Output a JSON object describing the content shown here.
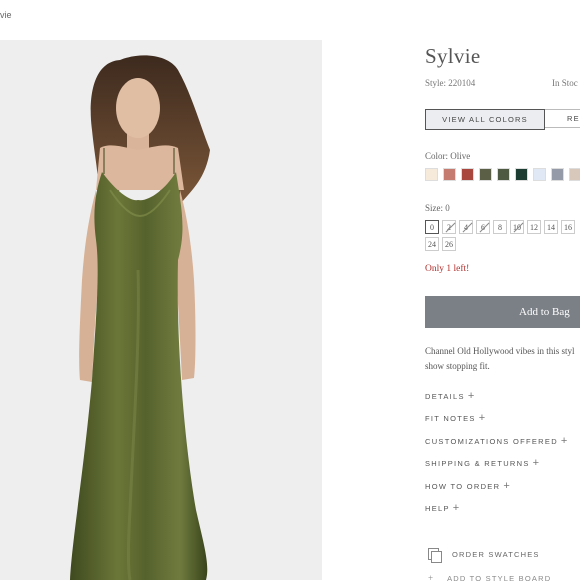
{
  "breadcrumb": {
    "current": "vie"
  },
  "product": {
    "title": "Sylvie",
    "style": "Style: 220104",
    "stock": "In Stoc",
    "view_all_colors": "VIEW ALL COLORS",
    "second_button": "RE",
    "color_label": "Color: Olive",
    "swatches": [
      {
        "name": "ivory",
        "color": "#f6eadb"
      },
      {
        "name": "rose",
        "color": "#c67b70"
      },
      {
        "name": "rust",
        "color": "#a9473f"
      },
      {
        "name": "olive",
        "color": "#5a5f45"
      },
      {
        "name": "moss",
        "color": "#4f5a43"
      },
      {
        "name": "emerald",
        "color": "#1c3d32"
      },
      {
        "name": "sky",
        "color": "#dfe8f4"
      },
      {
        "name": "slate",
        "color": "#959aa8"
      },
      {
        "name": "taupe",
        "color": "#d8c8bc"
      }
    ],
    "size_label": "Size: 0",
    "sizes": [
      {
        "label": "0",
        "state": "selected"
      },
      {
        "label": "2",
        "state": "soldout"
      },
      {
        "label": "4",
        "state": "soldout"
      },
      {
        "label": "6",
        "state": "soldout"
      },
      {
        "label": "8",
        "state": "available"
      },
      {
        "label": "10",
        "state": "soldout"
      },
      {
        "label": "12",
        "state": "available"
      },
      {
        "label": "14",
        "state": "available"
      },
      {
        "label": "16",
        "state": "available"
      },
      {
        "label": "24",
        "state": "available"
      },
      {
        "label": "26",
        "state": "available"
      }
    ],
    "only_left": "Only 1 left!",
    "add_to_bag": "Add to Bag",
    "description_line1": "Channel Old Hollywood vibes in this styl",
    "description_line2": "show stopping fit."
  },
  "accordion": [
    {
      "label": "DETAILS",
      "icon": "plus-icon"
    },
    {
      "label": "FIT NOTES",
      "icon": "plus-icon"
    },
    {
      "label": "CUSTOMIZATIONS OFFERED",
      "icon": "plus-icon"
    },
    {
      "label": "SHIPPING & RETURNS",
      "icon": "plus-icon"
    },
    {
      "label": "HOW TO ORDER",
      "icon": "plus-icon"
    },
    {
      "label": "HELP",
      "icon": "plus-icon"
    }
  ],
  "actions": {
    "order_swatches": "ORDER SWATCHES",
    "add_to_style_board": "ADD TO STYLE BOARD"
  },
  "colors": {
    "accent_button": "#7b8087",
    "alert": "#b1322f",
    "dress": "#4e5a2a"
  }
}
